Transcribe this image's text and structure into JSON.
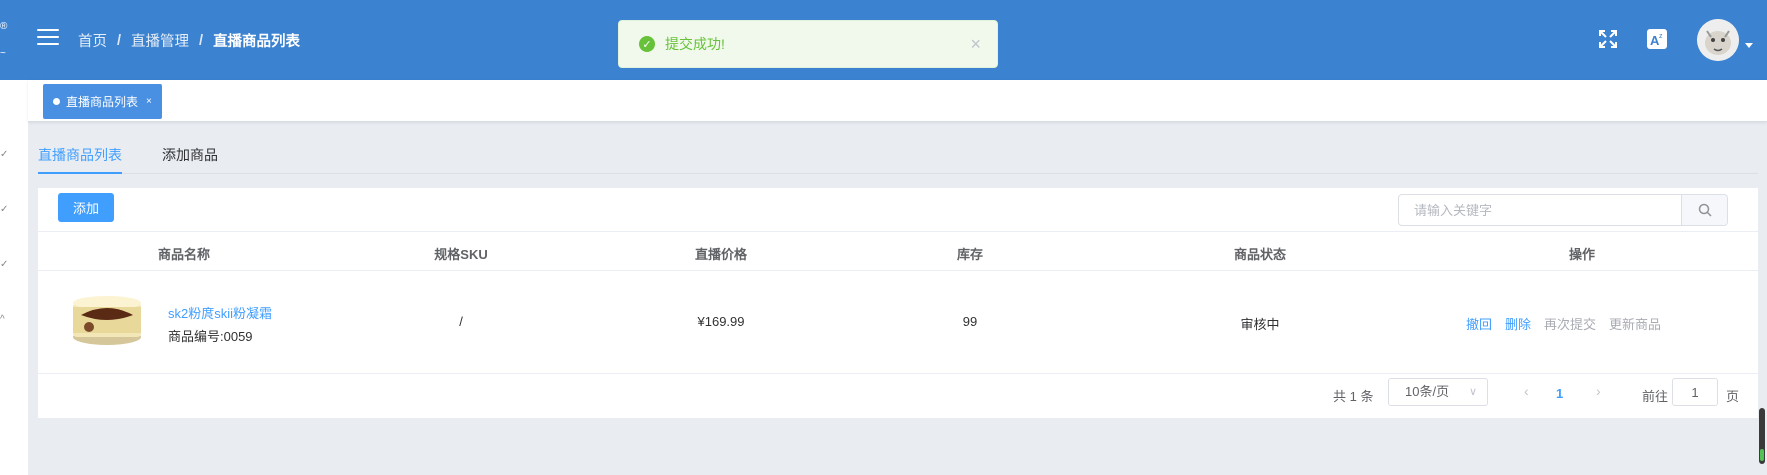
{
  "header": {
    "breadcrumb": [
      "首页",
      "直播管理",
      "直播商品列表"
    ],
    "separator": "/",
    "accent_color": "#3b82d0"
  },
  "toast": {
    "message": "提交成功!",
    "type": "success",
    "close_glyph": "×"
  },
  "tags_bar": {
    "active_tag": "直播商品列表",
    "close_glyph": "×"
  },
  "tabs": [
    {
      "label": "直播商品列表",
      "active": true
    },
    {
      "label": "添加商品",
      "active": false
    }
  ],
  "toolbar": {
    "add_label": "添加",
    "search_placeholder": "请输入关键字"
  },
  "table": {
    "columns": [
      "商品名称",
      "规格SKU",
      "直播价格",
      "库存",
      "商品状态",
      "操作"
    ],
    "rows": [
      {
        "name": "sk2粉庹skii粉凝霜",
        "code": "商品编号:0059",
        "sku": "/",
        "price": "¥169.99",
        "stock": "99",
        "status": "审核中",
        "actions": [
          "撤回",
          "删除",
          "再次提交",
          "更新商品"
        ]
      }
    ]
  },
  "pagination": {
    "total_text": "共 1 条",
    "page_size": "10条/页",
    "current_page": "1",
    "goto_label": "前往",
    "goto_value": "1",
    "page_suffix": "页"
  },
  "icons": {
    "menu": "hamburger-icon",
    "fullscreen": "fullscreen-icon",
    "translate": "translate-icon",
    "search": "search-icon",
    "success": "check-circle-icon"
  }
}
